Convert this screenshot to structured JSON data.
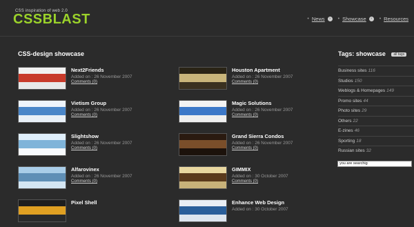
{
  "header": {
    "tagline": "CSS inspiration of web 2.0",
    "logo": "CSSBLAST",
    "nav": [
      {
        "label": "News",
        "arrow": "›"
      },
      {
        "label": "Showcase",
        "arrow": "›"
      },
      {
        "label": "Resources"
      }
    ],
    "colors": {
      "logo": "#9bd22a",
      "background": "#2b2b2b"
    }
  },
  "main": {
    "title": "CSS-design showcase",
    "entries": [
      {
        "name": "Next2Friends",
        "added": "Added on : 26 November 2007",
        "comments": "Comments (0)",
        "thumb": [
          "#f1f1f1",
          "#c83a2a",
          "#e8e8e8"
        ]
      },
      {
        "name": "Vietism Group",
        "added": "Added on : 26 November 2007",
        "comments": "Comments (0)",
        "thumb": [
          "#eef4fb",
          "#4a86c8",
          "#e9f0f7"
        ]
      },
      {
        "name": "Slightshow",
        "added": "Added on : 26 November 2007",
        "comments": "Comments (0)",
        "thumb": [
          "#dfeefa",
          "#7fb4d9",
          "#f6f9fc"
        ]
      },
      {
        "name": "Alfarovinex",
        "added": "Added on : 26 November 2007",
        "comments": "Comments (0)",
        "thumb": [
          "#a9cde8",
          "#5f8fb6",
          "#d4e6f3"
        ]
      },
      {
        "name": "Pixel Shell",
        "added": "",
        "comments": "",
        "thumb": [
          "#1e1e1e",
          "#e0a022",
          "#2a2a2a"
        ]
      },
      {
        "name": "Houston Apartment",
        "added": "Added on : 26 November 2007",
        "comments": "Comments (0)",
        "thumb": [
          "#2a2416",
          "#c9b57a",
          "#3a3120"
        ]
      },
      {
        "name": "Magic Solutions",
        "added": "Added on : 26 November 2007",
        "comments": "Comments (0)",
        "thumb": [
          "#f3f3f3",
          "#3c78c8",
          "#efefef"
        ]
      },
      {
        "name": "Grand Sierra Condos",
        "added": "Added on : 26 November 2007",
        "comments": "Comments (0)",
        "thumb": [
          "#2a1a10",
          "#7a4e2a",
          "#1c120b"
        ]
      },
      {
        "name": "GIMMIX",
        "added": "Added on : 30 October 2007",
        "comments": "Comments (0)",
        "thumb": [
          "#e8d7a0",
          "#5a3a1c",
          "#c8b27a"
        ]
      },
      {
        "name": "Enhance Web Design",
        "added": "Added on : 30 October 2007",
        "comments": "",
        "thumb": [
          "#e9eef4",
          "#2a5f9a",
          "#dde6ef"
        ]
      }
    ]
  },
  "sidebar": {
    "title": "Tags: showcase",
    "all_tags_label": "all tags",
    "tags": [
      {
        "label": "Business sites",
        "count": "116"
      },
      {
        "label": "Studios",
        "count": "150"
      },
      {
        "label": "Weblogs & Homepages",
        "count": "149"
      },
      {
        "label": "Promo sites",
        "count": "44"
      },
      {
        "label": "Photo sites",
        "count": "29"
      },
      {
        "label": "Others",
        "count": "22"
      },
      {
        "label": "E-zines",
        "count": "46"
      },
      {
        "label": "Sporting",
        "count": "18"
      },
      {
        "label": "Russian sites",
        "count": "32"
      }
    ],
    "search_value": "you are searchig"
  }
}
